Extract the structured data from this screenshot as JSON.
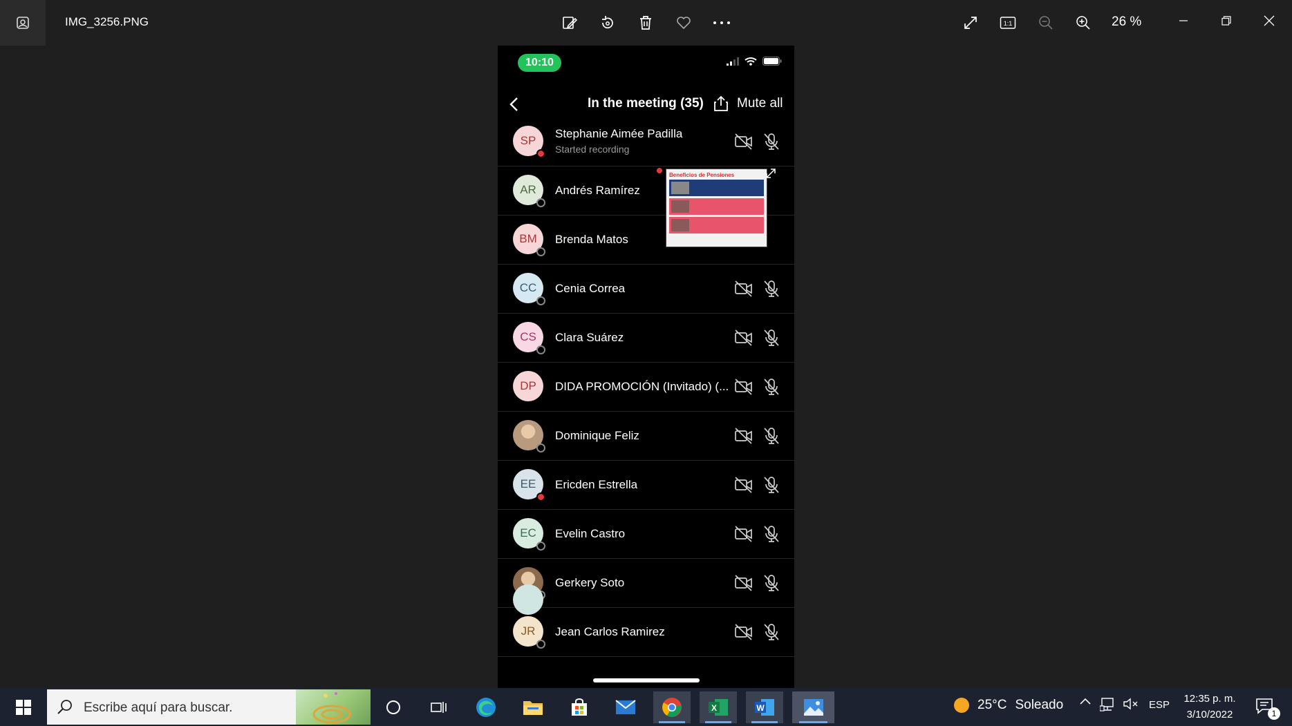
{
  "window": {
    "filename": "IMG_3256.PNG",
    "zoom": "26 %",
    "toolbar_icons": [
      "edit-icon",
      "rotate-icon",
      "delete-icon",
      "favorite-icon",
      "more-icon"
    ],
    "right_icons": [
      "fullscreen-icon",
      "actual-size-icon",
      "zoom-out-icon",
      "zoom-in-icon"
    ]
  },
  "phone": {
    "time": "10:10",
    "header": {
      "title": "In the meeting (35)",
      "mute_all": "Mute all"
    },
    "participants": [
      {
        "initials": "SP",
        "name": "Stephanie Aimée Padilla",
        "subtitle": "Started recording",
        "avatar_bg": "#f6d6d6",
        "avatar_fg": "#a5393b",
        "presence": "red",
        "controls": true
      },
      {
        "initials": "AR",
        "name": "Andrés Ramírez",
        "avatar_bg": "#dfeadb",
        "avatar_fg": "#4c6b45",
        "presence": "offline",
        "controls": false
      },
      {
        "initials": "BM",
        "name": "Brenda Matos",
        "avatar_bg": "#f6d6d6",
        "avatar_fg": "#a5393b",
        "presence": "offline",
        "controls": false
      },
      {
        "initials": "CC",
        "name": "Cenia Correa",
        "avatar_bg": "#d6e8f2",
        "avatar_fg": "#32607c",
        "presence": "offline",
        "controls": true
      },
      {
        "initials": "CS",
        "name": "Clara Suárez",
        "avatar_bg": "#f8d8e4",
        "avatar_fg": "#a3385d",
        "presence": "offline",
        "controls": true
      },
      {
        "initials": "DP",
        "name": "DIDA PROMOCIÓN (Invitado) (...",
        "avatar_bg": "#f6d6d6",
        "avatar_fg": "#a5393b",
        "presence": "none",
        "controls": true
      },
      {
        "initials": "",
        "name": "Dominique Feliz",
        "avatar_bg": "#b89a7e",
        "avatar_fg": "#ffffff",
        "presence": "offline",
        "controls": true,
        "photo": true
      },
      {
        "initials": "EE",
        "name": "Ericden Estrella",
        "avatar_bg": "#d8e4ea",
        "avatar_fg": "#3d5968",
        "presence": "red",
        "controls": true
      },
      {
        "initials": "EC",
        "name": "Evelin Castro",
        "avatar_bg": "#d9ece0",
        "avatar_fg": "#3e6b4d",
        "presence": "offline",
        "controls": true
      },
      {
        "initials": "",
        "name": "Gerkery Soto",
        "avatar_bg": "#8b6a4e",
        "avatar_fg": "#ffffff",
        "presence": "offline",
        "controls": true,
        "photo": true
      },
      {
        "initials": "JR",
        "name": "Jean Carlos Ramirez",
        "avatar_bg": "#f5e4cc",
        "avatar_fg": "#8a5a22",
        "presence": "offline",
        "controls": true
      }
    ],
    "shared_content": {
      "title": "Beneficios de Pensiones"
    }
  },
  "taskbar": {
    "search_placeholder": "Escribe aquí para buscar.",
    "apps": [
      "cortana-icon",
      "task-view-icon",
      "edge-icon",
      "file-explorer-icon",
      "store-icon",
      "mail-icon",
      "chrome-icon",
      "excel-icon",
      "word-icon",
      "photos-icon"
    ],
    "weather": {
      "temp": "25°C",
      "condition": "Soleado"
    },
    "language": "ESP",
    "time": "12:35 p. m.",
    "date": "3/10/2022",
    "notifications": "1"
  }
}
